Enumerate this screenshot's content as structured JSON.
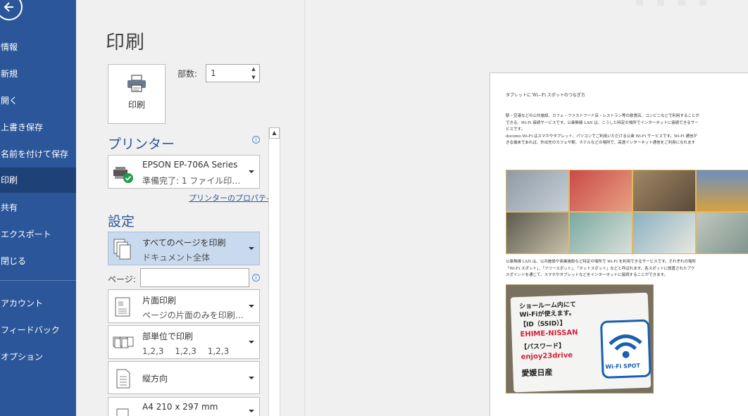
{
  "sidebar": {
    "items": [
      {
        "label": "情報"
      },
      {
        "label": "新規"
      },
      {
        "label": "開く"
      },
      {
        "label": "上書き保存"
      },
      {
        "label": "名前を付けて保存"
      },
      {
        "label": "印刷"
      },
      {
        "label": "共有"
      },
      {
        "label": "エクスポート"
      },
      {
        "label": "閉じる"
      },
      {
        "label": "アカウント"
      },
      {
        "label": "フィードバック"
      },
      {
        "label": "オプション"
      }
    ],
    "active_index": 5,
    "bg_color": "#2b579a"
  },
  "main": {
    "title": "印刷",
    "print_button_label": "印刷",
    "copies_label": "部数:",
    "copies_value": "1",
    "printer_section": "プリンター",
    "printer_name": "EPSON EP-706A Series",
    "printer_status": "準備完了: 1 ファイル印…",
    "printer_properties_link": "プリンターのプロパティ",
    "settings_section": "設定",
    "settings": [
      {
        "line1": "すべてのページを印刷",
        "line2": "ドキュメント全体"
      },
      {
        "line1": "片面印刷",
        "line2": "ページの片面のみを印刷…"
      },
      {
        "line1": "部単位で印刷",
        "line2": "1,2,3　 1,2,3　 1,2,3"
      },
      {
        "line1": "縦方向",
        "line2": ""
      },
      {
        "line1": "A4 210 x 297 mm",
        "line2": ""
      }
    ],
    "pages_label": "ページ:",
    "pages_value": ""
  },
  "preview": {
    "doc_title": "タブレットに Wi−Fi スポットのつなぎ方",
    "para1": [
      "駅・空港などの公共施設、カフェ・ファストフード店・レストラン等の飲食店、コンビニなどで利用することが",
      "できる、Wi-Fi 接続サービスです。公衆無線 LAN は、こうした特定の場所でインターネットに接続できるサー",
      "ビスです。",
      "docomo Wi-Fi はスマホやタブレット、パソコンでご利用いただける公衆 Wi-Fi サービスです。Wi-Fi 通信が",
      "きる端末であれば、外出先のカフェや駅、ホテルなどの場所で、高速インターネット通信をご利用になれます"
    ],
    "para2": [
      "公衆無線 LAN は、公共施設や商業施設など特定の場所で Wi-Fi を利用できるサービスです。それぞれの場所",
      "「Wi-Fi スポット」、「フリースポット」、「ホットスポット」などと呼ばれます。各スポットに設置されたアク",
      "スポイントを通じて、スマホやタブレットなどをインターネットに接続することができます。"
    ],
    "wifi_card": {
      "line1": "ショールーム内にて",
      "line2": "Wi-Fiが使えます。",
      "line3": "【ID（SSID）】",
      "line4": "EHIME-NISSAN",
      "line5": "【パスワード】",
      "line6": "enjoy23drive",
      "line7": "愛媛日産",
      "spot_label": "Wi-Fi SPOT"
    }
  }
}
